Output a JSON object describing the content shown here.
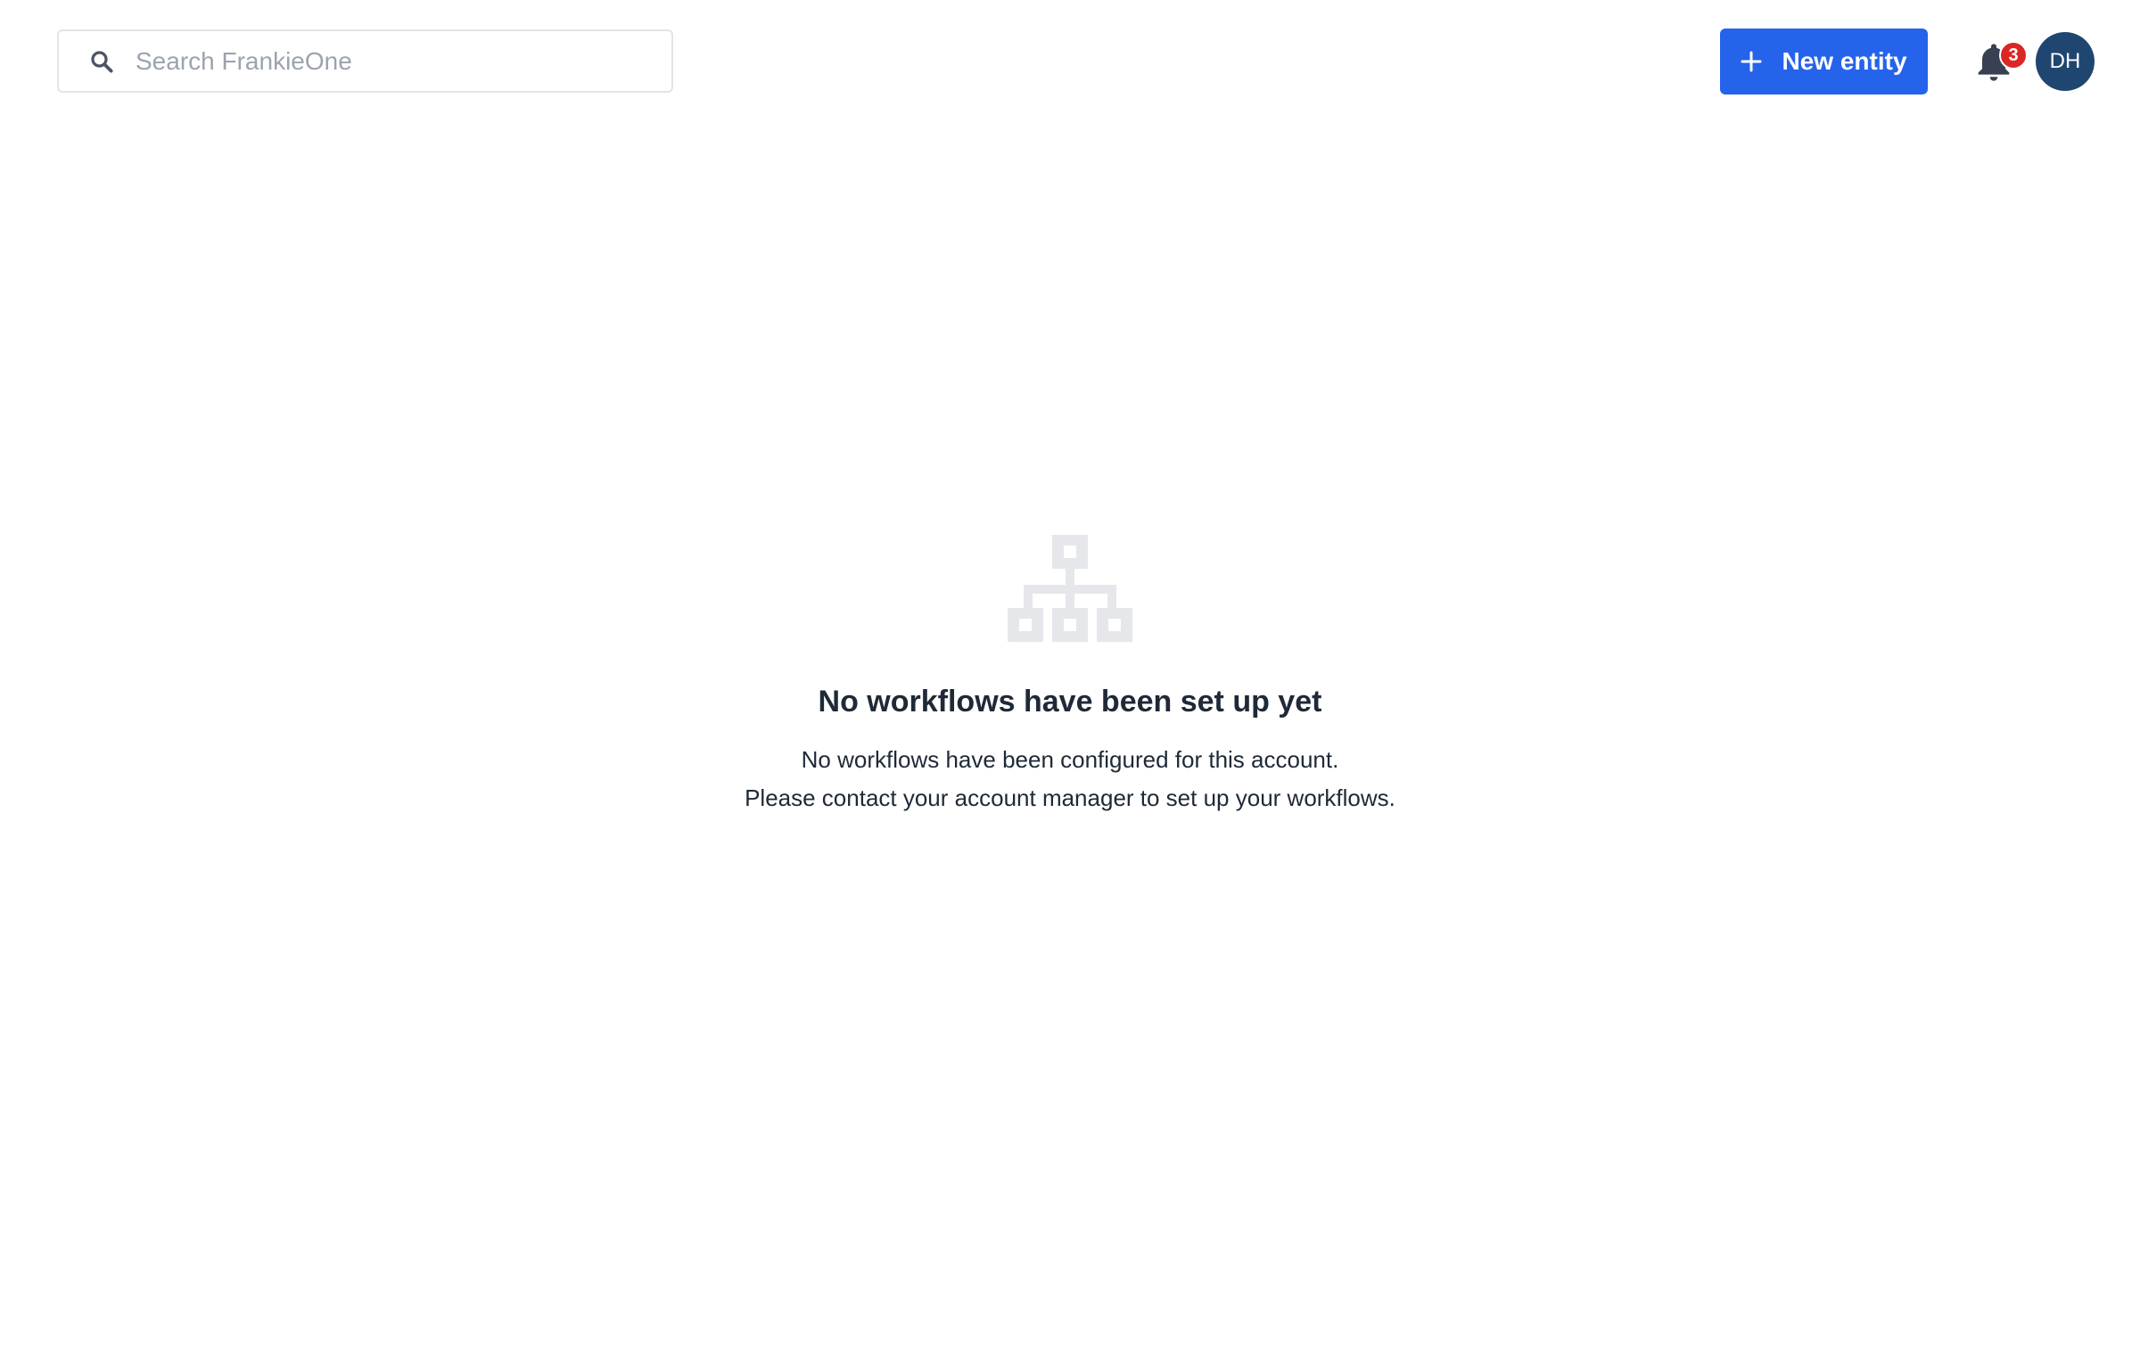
{
  "header": {
    "search": {
      "placeholder": "Search FrankieOne",
      "value": "",
      "icon": "search-icon"
    },
    "new_entity_button": {
      "label": "New entity",
      "icon": "plus-icon",
      "color": "#2563eb"
    },
    "notifications": {
      "icon": "bell-icon",
      "count": "3",
      "badge_color": "#dc2626"
    },
    "user": {
      "initials": "DH",
      "avatar_color": "#1f4670"
    }
  },
  "empty_state": {
    "icon": "workflow-hierarchy-icon",
    "title": "No workflows have been set up yet",
    "line1": "No workflows have been configured for this account.",
    "line2": "Please contact your account manager to set up your workflows."
  }
}
